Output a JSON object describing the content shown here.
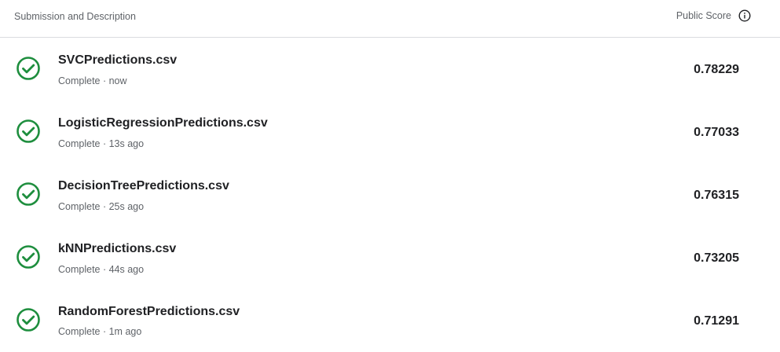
{
  "header": {
    "submission_label": "Submission and Description",
    "score_label": "Public Score",
    "info_icon": "info-icon"
  },
  "colors": {
    "success": "#1e8e3e",
    "divider": "#dadce0",
    "secondary_text": "#5f6368",
    "primary_text": "#202124"
  },
  "submissions": [
    {
      "file": "SVCPredictions.csv",
      "status": "Complete",
      "time": "now",
      "status_text": "Complete · now",
      "score": "0.78229",
      "icon": "check-circle-icon"
    },
    {
      "file": "LogisticRegressionPredictions.csv",
      "status": "Complete",
      "time": "13s ago",
      "status_text": "Complete · 13s ago",
      "score": "0.77033",
      "icon": "check-circle-icon"
    },
    {
      "file": "DecisionTreePredictions.csv",
      "status": "Complete",
      "time": "25s ago",
      "status_text": "Complete · 25s ago",
      "score": "0.76315",
      "icon": "check-circle-icon"
    },
    {
      "file": "kNNPredictions.csv",
      "status": "Complete",
      "time": "44s ago",
      "status_text": "Complete · 44s ago",
      "score": "0.73205",
      "icon": "check-circle-icon"
    },
    {
      "file": "RandomForestPredictions.csv",
      "status": "Complete",
      "time": "1m ago",
      "status_text": "Complete · 1m ago",
      "score": "0.71291",
      "icon": "check-circle-icon"
    }
  ]
}
